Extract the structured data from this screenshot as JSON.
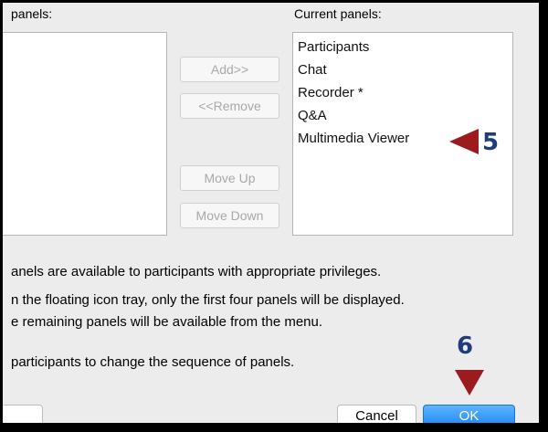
{
  "dialog": {
    "available_label": "panels:",
    "current_label": "Current panels:",
    "current_panels": [
      "Participants",
      "Chat",
      "Recorder *",
      "Q&A",
      "Multimedia Viewer"
    ],
    "buttons": {
      "add": "Add>>",
      "remove": "<<Remove",
      "move_up": "Move Up",
      "move_down": "Move Down"
    },
    "notes": [
      "anels are available to participants with appropriate privileges.",
      "n the floating icon tray, only the first four panels will be displayed.",
      "e remaining panels will be available from the menu.",
      "participants to change the sequence of panels."
    ],
    "footer": {
      "cancel": "Cancel",
      "ok": "OK"
    }
  },
  "annotations": {
    "step5": "5",
    "step6": "6",
    "arrow_color": "#9b1b1f",
    "number_color": "#1f3d7a"
  },
  "colors": {
    "accent": "#1b85f5",
    "frame": "#000000",
    "background": "#ececec"
  }
}
